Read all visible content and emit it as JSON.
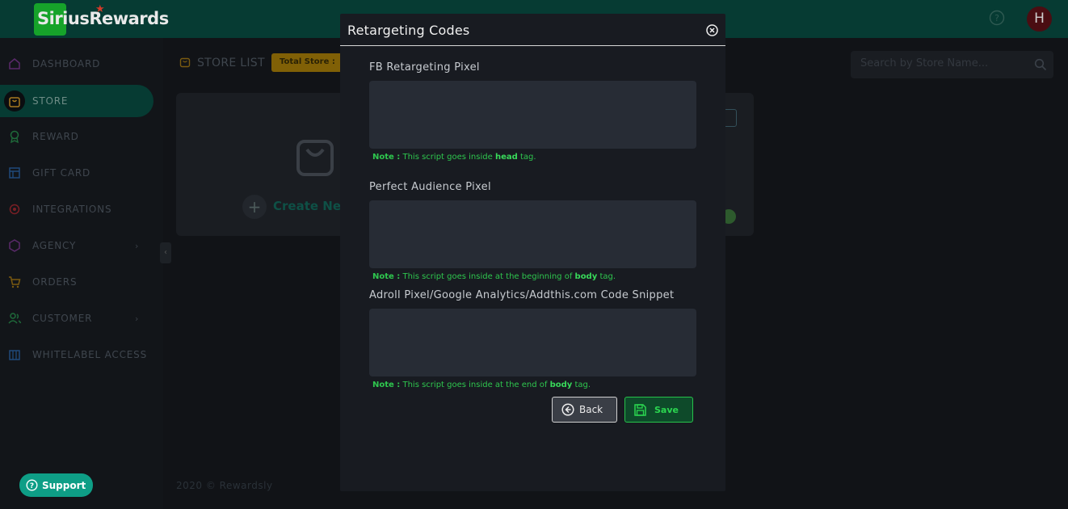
{
  "app": {
    "logo_text": "SiriusRewards",
    "avatar_initial": "H",
    "footer": "2020 © Rewardsly",
    "support_label": "Support"
  },
  "sidebar": {
    "items": [
      {
        "label": "DASHBOARD",
        "icon": "home-icon",
        "color": "#5a2a6a"
      },
      {
        "label": "STORE",
        "icon": "bag-icon",
        "color": "#a87a20",
        "active": true
      },
      {
        "label": "REWARD",
        "icon": "award-icon",
        "color": "#1f6a3a"
      },
      {
        "label": "GIFT CARD",
        "icon": "gift-card-icon",
        "color": "#1f4a7a"
      },
      {
        "label": "INTEGRATIONS",
        "icon": "integrations-icon",
        "color": "#7a1f25"
      },
      {
        "label": "AGENCY",
        "icon": "cube-icon",
        "color": "#5a2a6a"
      },
      {
        "label": "ORDERS",
        "icon": "cart-icon",
        "color": "#7a5a10"
      },
      {
        "label": "CUSTOMER",
        "icon": "users-icon",
        "color": "#1f6a3a"
      },
      {
        "label": "WHITELABEL ACCESS",
        "icon": "building-icon",
        "color": "#1f4a7a"
      }
    ]
  },
  "store_page": {
    "title": "STORE LIST",
    "total_store_label": "Total Store :",
    "search_placeholder": "Search by Store Name...",
    "create_label": "Create New"
  },
  "modal": {
    "title": "Retargeting Codes",
    "fields": [
      {
        "label": "FB Retargeting Pixel",
        "value": "",
        "note_key": "Note :",
        "note_before": "This script goes inside",
        "note_tag": "head",
        "note_after": "tag."
      },
      {
        "label": "Perfect Audience Pixel",
        "value": "",
        "note_key": "Note :",
        "note_before": "This script goes inside at the beginning of",
        "note_tag": "body",
        "note_after": "tag."
      },
      {
        "label": "Adroll Pixel/Google Analytics/Addthis.com Code Snippet",
        "value": "",
        "note_key": "Note :",
        "note_before": "This script goes inside at the end of",
        "note_tag": "body",
        "note_after": "tag."
      }
    ],
    "back_label": "Back",
    "save_label": "Save"
  },
  "colors": {
    "accent_green": "#2ec64e",
    "topbar": "#063b33",
    "support": "#0e9e86"
  }
}
